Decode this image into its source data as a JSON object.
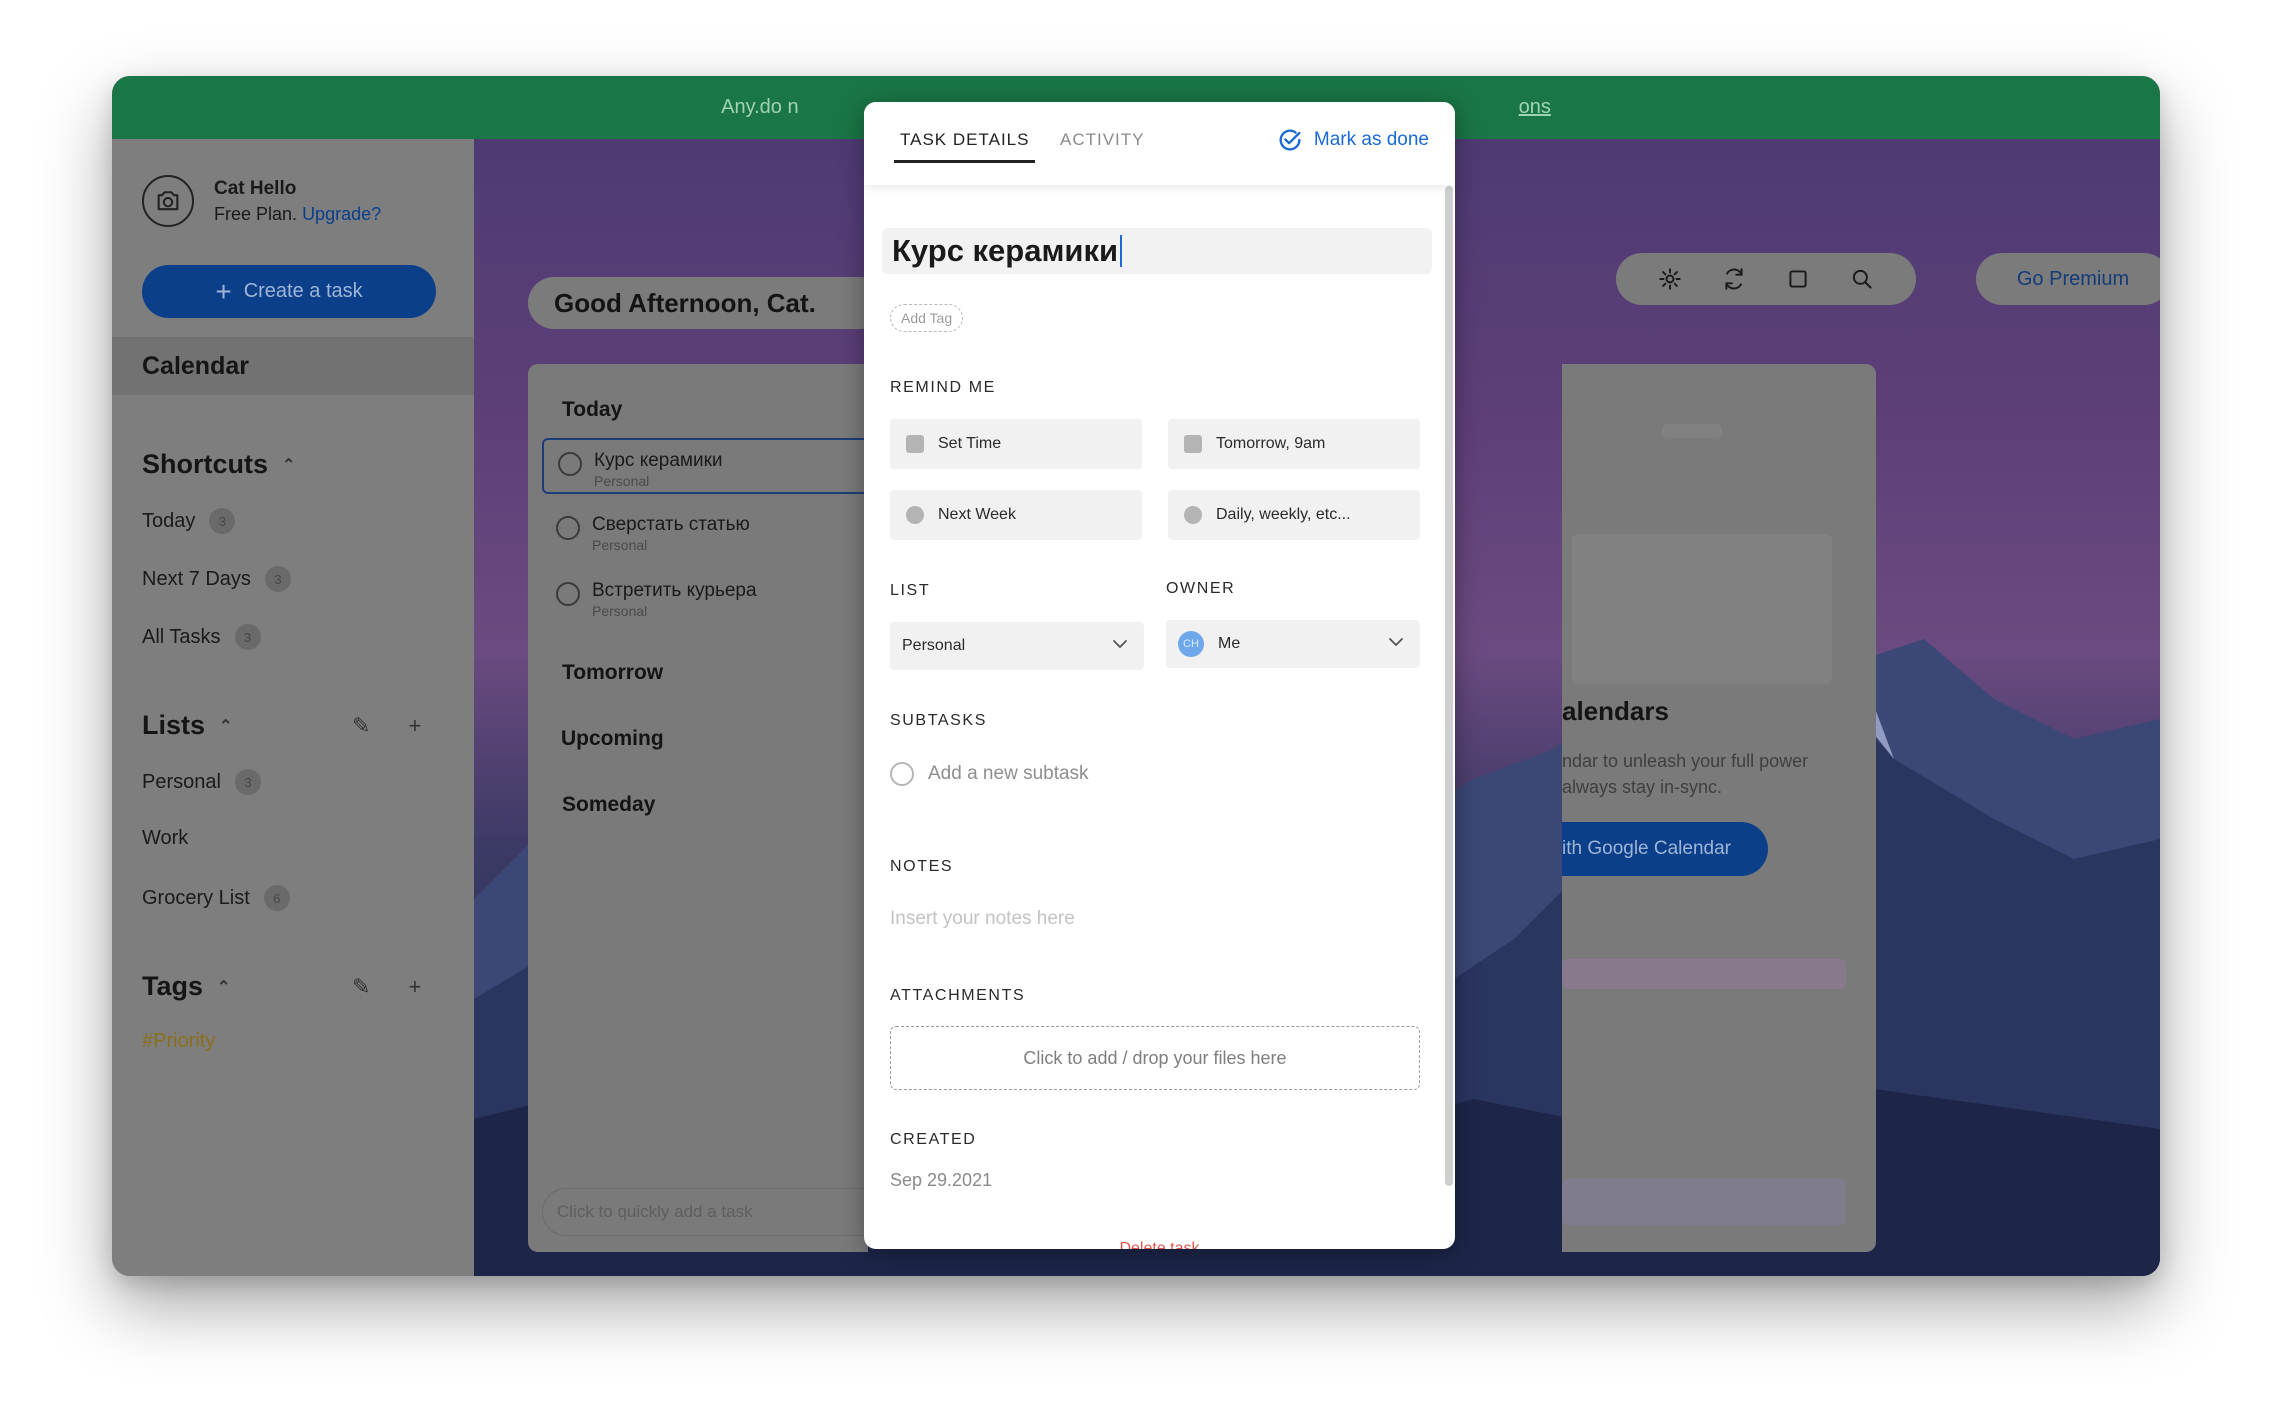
{
  "banner": {
    "text_visible": "Any.do n",
    "link_visible": "ons"
  },
  "profile": {
    "name": "Cat Hello",
    "plan": "Free Plan.",
    "upgrade": "Upgrade?"
  },
  "sidebar": {
    "create_label": "Create a task",
    "calendar": "Calendar",
    "shortcuts_title": "Shortcuts",
    "shortcuts": [
      {
        "label": "Today",
        "count": "3"
      },
      {
        "label": "Next 7 Days",
        "count": "3"
      },
      {
        "label": "All Tasks",
        "count": "3"
      }
    ],
    "lists_title": "Lists",
    "lists": [
      {
        "label": "Personal",
        "count": "3"
      },
      {
        "label": "Work",
        "count": ""
      },
      {
        "label": "Grocery List",
        "count": "6"
      }
    ],
    "tags_title": "Tags",
    "tags": [
      {
        "label": "#Priority"
      }
    ]
  },
  "main": {
    "greeting": "Good Afternoon, Cat.",
    "premium": "Go Premium",
    "toolbar_icons": [
      "gear-icon",
      "sync-icon",
      "square-icon",
      "search-icon"
    ],
    "groups": {
      "today": "Today",
      "tomorrow": "Tomorrow",
      "upcoming": "Upcoming",
      "someday": "Someday"
    },
    "tasks": [
      {
        "title": "Курс керамики",
        "list": "Personal"
      },
      {
        "title": "Сверстать статью",
        "list": "Personal"
      },
      {
        "title": "Встретить курьера",
        "list": "Personal"
      }
    ],
    "quick_add_placeholder": "Click to quickly add a task",
    "calendar_panel": {
      "title": "alendars",
      "desc_line1": "ndar to unleash your full power",
      "desc_line2": "always stay in-sync.",
      "button": "ith Google Calendar"
    }
  },
  "modal": {
    "tab_details": "TASK DETAILS",
    "tab_activity": "ACTIVITY",
    "mark_done": "Mark as done",
    "title": "Курс керамики",
    "add_tag": "Add Tag",
    "remind_label": "REMIND ME",
    "remind_options": [
      "Set Time",
      "Tomorrow, 9am",
      "Next Week",
      "Daily, weekly, etc..."
    ],
    "list_label": "LIST",
    "list_value": "Personal",
    "owner_label": "OWNER",
    "owner_initials": "CH",
    "owner_value": "Me",
    "subtasks_label": "SUBTASKS",
    "subtask_placeholder": "Add a new subtask",
    "notes_label": "NOTES",
    "notes_placeholder": "Insert your notes here",
    "attachments_label": "ATTACHMENTS",
    "attachments_drop": "Click to add / drop your files here",
    "created_label": "CREATED",
    "created_value": "Sep 29.2021",
    "delete": "Delete task"
  },
  "colors": {
    "banner": "#1a7646",
    "primary_button": "#0b3f89",
    "link": "#1a6ad6",
    "delete": "#e0524a"
  }
}
